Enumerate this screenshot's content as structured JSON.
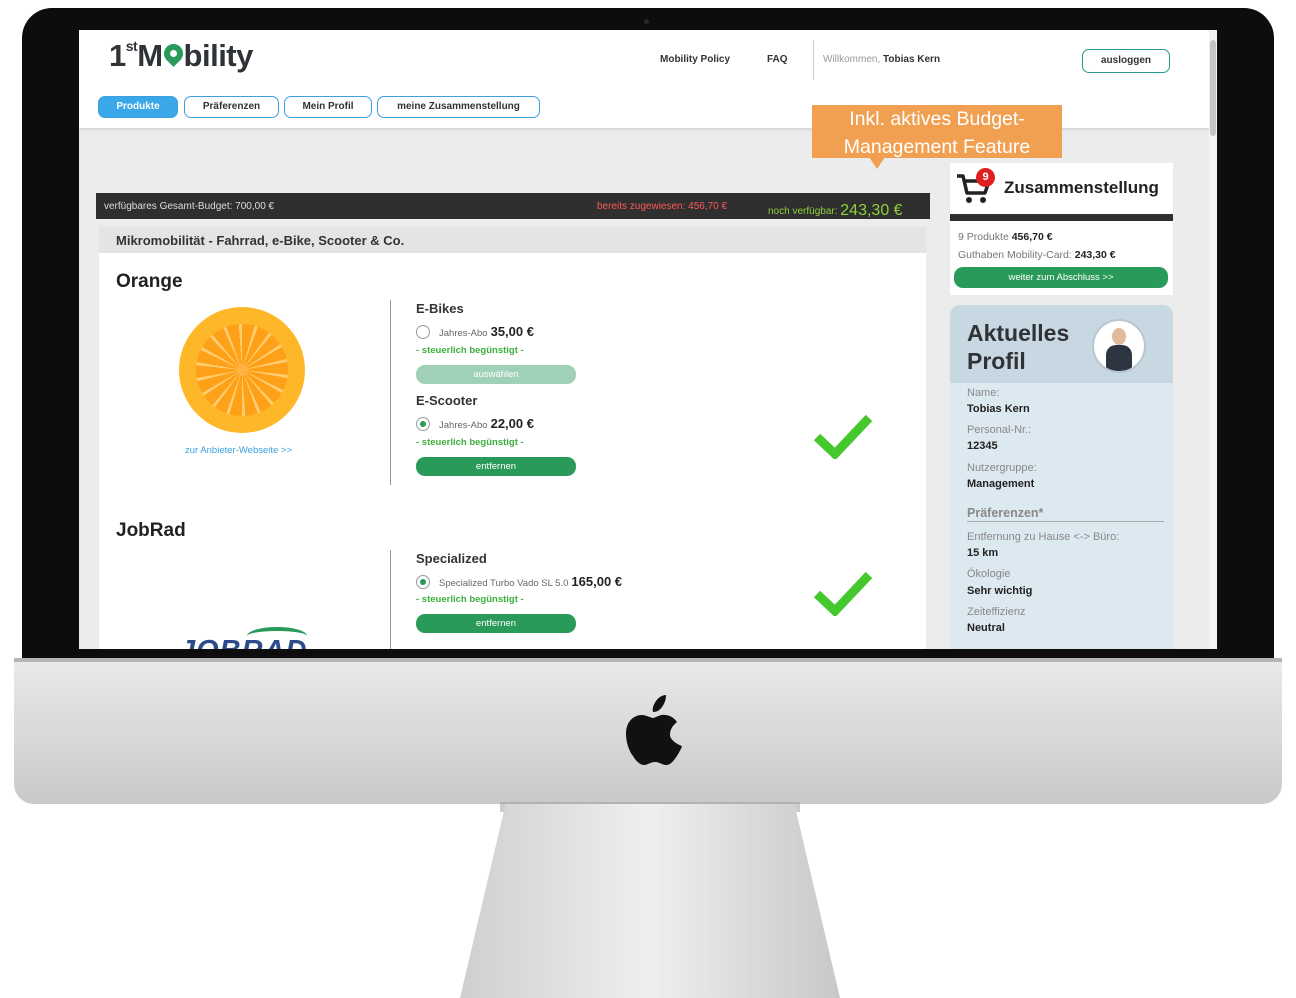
{
  "header": {
    "logo_main": "1",
    "logo_sup": "st",
    "logo_m": "M",
    "logo_rest": "bility",
    "nav": [
      "Mobility Policy",
      "FAQ"
    ],
    "welcome_prefix": "Willkommen,",
    "welcome_name": "Tobias Kern",
    "logout": "ausloggen",
    "tabs": [
      "Produkte",
      "Präferenzen",
      "Mein Profil",
      "meine Zusammenstellung"
    ]
  },
  "callout": {
    "line1": "Inkl. aktives Budget-",
    "line2": "Management Feature"
  },
  "budget": {
    "total": "verfügbares Gesamt-Budget: 700,00 €",
    "assigned": "bereits zugewiesen: 456,70 €",
    "remaining_label": "noch verfügbar:",
    "remaining_value": "243,30 €"
  },
  "category": "Mikromobilität - Fahrrad, e-Bike, Scooter & Co.",
  "providers": [
    {
      "name": "Orange",
      "link": "zur Anbieter-Webseite >>",
      "products": [
        {
          "title": "E-Bikes",
          "option": "Jahres-Abo",
          "price": "35,00 €",
          "tax": "- steuerlich begünstigt -",
          "button": "auswählen",
          "selected": false
        },
        {
          "title": "E-Scooter",
          "option": "Jahres-Abo",
          "price": "22,00 €",
          "tax": "- steuerlich begünstigt -",
          "button": "entfernen",
          "selected": true
        }
      ]
    },
    {
      "name": "JobRad",
      "logo_text": "JOBRAD",
      "products": [
        {
          "title": "Specialized",
          "option": "Specialized Turbo Vado SL 5.0",
          "price": "165,00 €",
          "tax": "- steuerlich begünstigt -",
          "button": "entfernen",
          "selected": true
        }
      ]
    }
  ],
  "cart": {
    "badge": "9",
    "title": "Zusammenstellung",
    "products_label": "9 Produkte",
    "products_value": "456,70 €",
    "credit_label": "Guthaben Mobility-Card:",
    "credit_value": "243,30 €",
    "button": "weiter zum Abschluss >>"
  },
  "profile": {
    "title": "Aktuelles Profil",
    "fields": [
      {
        "label": "Name:",
        "value": "Tobias Kern"
      },
      {
        "label": "Personal-Nr.:",
        "value": "12345"
      },
      {
        "label": "Nutzergruppe:",
        "value": "Management"
      }
    ],
    "preferences_title": "Präferenzen*",
    "preferences": [
      {
        "label": "Entfernung zu Hause <-> Büro:",
        "value": "15 km"
      },
      {
        "label": "Ökologie",
        "value": "Sehr wichtig"
      },
      {
        "label": "Zeiteffizienz",
        "value": "Neutral"
      }
    ]
  },
  "colors": {
    "accent_green": "#2a9a5a",
    "tab_blue": "#3aa8e8",
    "callout_orange": "#f0a050",
    "assigned_red": "#ff5a5a",
    "remaining_green": "#8ed03a"
  }
}
